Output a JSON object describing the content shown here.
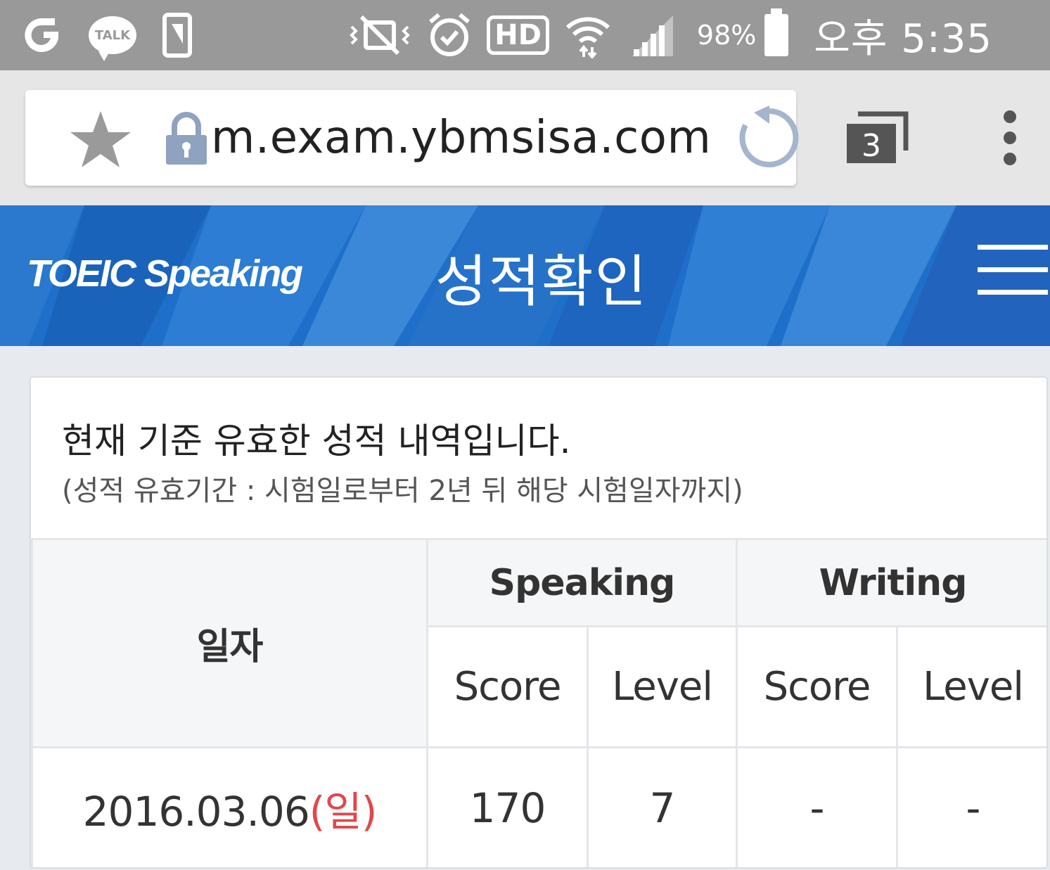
{
  "status_bar": {
    "left_icons": [
      "g-app-icon",
      "kakao-talk-icon",
      "phone-screen-icon"
    ],
    "talk_label": "TALK",
    "hd_label": "HD",
    "battery_percent": "98%",
    "time": "오후 5:35",
    "right_icons": [
      "vibrate-mute-icon",
      "alarm-icon",
      "hd-voice-icon",
      "wifi-icon",
      "signal-icon",
      "battery-icon"
    ]
  },
  "browser": {
    "url": "m.exam.ybmsisa.com",
    "tab_count": "3"
  },
  "header": {
    "logo": "TOEIC Speaking",
    "title": "성적확인",
    "accent_color": "#1f6fc8"
  },
  "card": {
    "title": "현재 기준 유효한 성적 내역입니다.",
    "subtitle": "(성적 유효기간 : 시험일로부터 2년 뒤 해당 시험일자까지)"
  },
  "table": {
    "col_date": "일자",
    "group_speaking": "Speaking",
    "group_writing": "Writing",
    "sub_headers": [
      "Score",
      "Level",
      "Score",
      "Level"
    ],
    "rows": [
      {
        "date": "2016.03.06",
        "day": "(일)",
        "speaking_score": "170",
        "speaking_level": "7",
        "writing_score": "-",
        "writing_level": "-"
      }
    ]
  }
}
